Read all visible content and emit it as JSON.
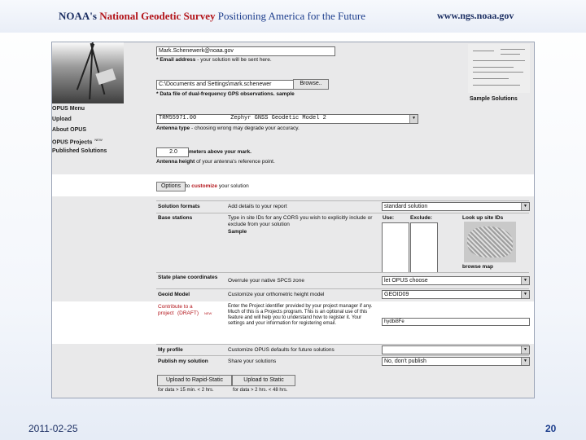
{
  "header": {
    "org": "NOAA's",
    "agency": "National Geodetic Survey",
    "tagline": "Positioning America for the Future",
    "url": "www.ngs.noaa.gov"
  },
  "opus_form": {
    "email_value": "Mark.Schenewerk@noaa.gov",
    "email_note_bold": "* Email address",
    "email_note_rest": " - your solution will be sent here.",
    "file_value": "C:\\Documents and Settings\\mark.schenewer",
    "browse_label": "Browse..",
    "file_note": "* Data file of dual-frequency GPS observations.",
    "file_note_link": "sample",
    "sample_solutions": "Sample Solutions",
    "antenna_value": "TRM55971.00          Zephyr GNSS Geodetic Model 2",
    "antenna_note_bold": "Antenna type",
    "antenna_note_rest": " - choosing wrong may degrade your accuracy.",
    "height_value": "2.0",
    "height_unit": "meters above your mark.",
    "height_note_bold": "Antenna height",
    "height_note_rest": " of your antenna's reference point.",
    "nav": [
      "OPUS Menu",
      "Upload",
      "About OPUS",
      "OPUS Projects",
      "Published Solutions"
    ],
    "nav_new": "NEW",
    "options_button": "Options",
    "options_text_pre": "to ",
    "options_text_link": "customize",
    "options_text_post": " your solution",
    "rows": {
      "formats_label": "Solution formats",
      "formats_desc": "Add details to your report",
      "formats_value": "standard solution",
      "stations_label": "Base stations",
      "stations_desc": "Type in site IDs for any CORS you wish to explicitly include or exclude from your solution",
      "stations_sample": "Sample",
      "use_label": "Use:",
      "exclude_label": "Exclude:",
      "lookup_label": "Look up site IDs",
      "browse_map": "browse map",
      "spc_label": "State plane coordinates",
      "spc_desc": "Overrule your native SPCS zone",
      "spc_value": "let OPUS choose",
      "geoid_label": "Geoid Model",
      "geoid_desc": "Customize your orthometric height model",
      "geoid_value": "GEOID09",
      "contribute_label": "Contribute to a project",
      "contribute_draft": "(DRAFT)",
      "contribute_new": "NEW",
      "contribute_desc": "Enter the Project identifier provided by your project manager if any. Much of this is a Projects program. This is an optional use of this feature and will help you to understand how to register it. Your settings and your information for registering email.",
      "contribute_value": "hydbi8Fe",
      "profile_label": "My profile",
      "profile_desc": "Customize OPUS defaults for future solutions",
      "publish_label": "Publish my solution",
      "publish_desc": "Share your solutions",
      "publish_value": "No, don't publish"
    },
    "upload_rapid": "Upload to Rapid-Static",
    "upload_static": "Upload to Static",
    "rapid_note": "for data > 15 min. < 2 hrs.",
    "static_note": "for data > 2 hrs. < 48 hrs."
  },
  "footer": {
    "date": "2011-02-25",
    "page": "20"
  }
}
